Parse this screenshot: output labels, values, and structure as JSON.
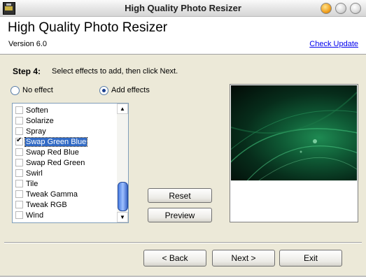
{
  "window": {
    "title": "High Quality Photo Resizer",
    "controls": [
      "minimize-icon",
      "maximize-icon",
      "close-icon"
    ]
  },
  "header": {
    "app_name": "High Quality Photo Resizer",
    "version": "Version 6.0",
    "check_update": "Check Update"
  },
  "step": {
    "title": "Step 4:",
    "description": "Select effects to add, then click Next."
  },
  "options": {
    "no_effect": "No effect",
    "add_effects": "Add effects",
    "selected": "add_effects"
  },
  "effects_list": {
    "items": [
      {
        "label": "Soften",
        "checked": false,
        "selected": false
      },
      {
        "label": "Solarize",
        "checked": false,
        "selected": false
      },
      {
        "label": "Spray",
        "checked": false,
        "selected": false
      },
      {
        "label": "Swap Green Blue",
        "checked": true,
        "selected": true
      },
      {
        "label": "Swap Red Blue",
        "checked": false,
        "selected": false
      },
      {
        "label": "Swap Red Green",
        "checked": false,
        "selected": false
      },
      {
        "label": "Swirl",
        "checked": false,
        "selected": false
      },
      {
        "label": "Tile",
        "checked": false,
        "selected": false
      },
      {
        "label": "Tweak Gamma",
        "checked": false,
        "selected": false
      },
      {
        "label": "Tweak RGB",
        "checked": false,
        "selected": false
      },
      {
        "label": "Wind",
        "checked": false,
        "selected": false
      }
    ]
  },
  "buttons": {
    "reset": "Reset",
    "preview": "Preview",
    "back": "< Back",
    "next": "Next >",
    "exit": "Exit"
  },
  "colors": {
    "selection": "#316ac5",
    "link": "#0000ee",
    "preview_dominant": "#0f5a35"
  }
}
